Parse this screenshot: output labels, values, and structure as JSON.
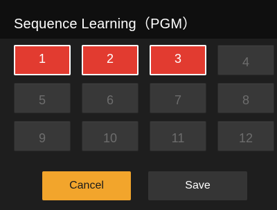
{
  "dialog": {
    "title": "Sequence Learning（PGM）"
  },
  "grid": {
    "cells": [
      {
        "label": "1",
        "selected": true
      },
      {
        "label": "2",
        "selected": true
      },
      {
        "label": "3",
        "selected": true
      },
      {
        "label": "4",
        "selected": false
      },
      {
        "label": "5",
        "selected": false
      },
      {
        "label": "6",
        "selected": false
      },
      {
        "label": "7",
        "selected": false
      },
      {
        "label": "8",
        "selected": false
      },
      {
        "label": "9",
        "selected": false
      },
      {
        "label": "10",
        "selected": false
      },
      {
        "label": "11",
        "selected": false
      },
      {
        "label": "12",
        "selected": false
      }
    ]
  },
  "buttons": {
    "cancel_label": "Cancel",
    "save_label": "Save"
  },
  "colors": {
    "selected": "#e23b30",
    "unselected": "#383838",
    "cancel": "#f2a52c",
    "save": "#353535"
  }
}
